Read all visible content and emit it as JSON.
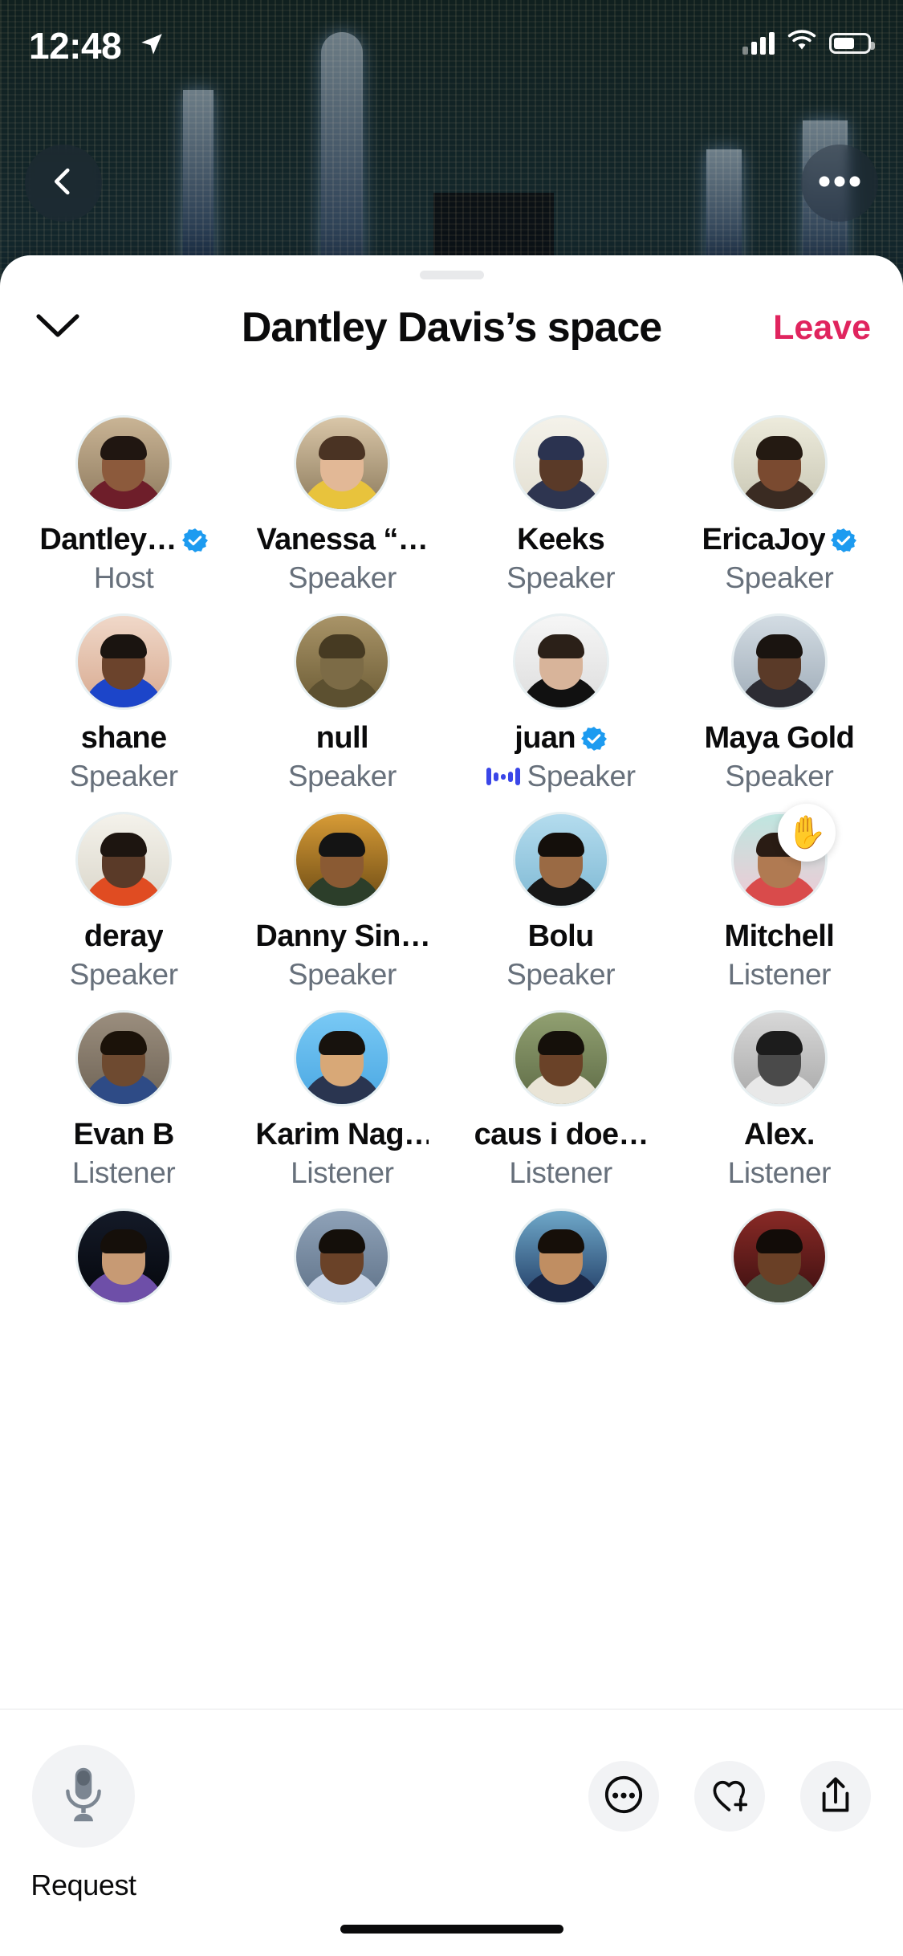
{
  "status_bar": {
    "time": "12:48",
    "location_icon": "location-arrow-icon",
    "signal_icon": "cellular-signal-icon",
    "wifi_icon": "wifi-icon",
    "battery_icon": "battery-icon"
  },
  "photo_overlay": {
    "back_icon": "chevron-left-icon",
    "more_icon": "ellipsis-icon"
  },
  "sheet": {
    "grabber": "drag-handle",
    "collapse_icon": "chevron-down-icon",
    "title": "Dantley Davis’s space",
    "leave_label": "Leave",
    "accent_leave_color": "#E0245E",
    "verified_color": "#1D9BF0",
    "speaking_color": "#3A46E8",
    "role_text_color": "#67707B"
  },
  "participants": [
    {
      "name": "Dantley…",
      "role": "Host",
      "verified": true,
      "speaking": false,
      "hand_raised": false
    },
    {
      "name": "Vanessa “…",
      "role": "Speaker",
      "verified": false,
      "speaking": false,
      "hand_raised": false
    },
    {
      "name": "Keeks",
      "role": "Speaker",
      "verified": false,
      "speaking": false,
      "hand_raised": false
    },
    {
      "name": "EricaJoy",
      "role": "Speaker",
      "verified": true,
      "speaking": false,
      "hand_raised": false
    },
    {
      "name": "shane",
      "role": "Speaker",
      "verified": false,
      "speaking": false,
      "hand_raised": false
    },
    {
      "name": "null",
      "role": "Speaker",
      "verified": false,
      "speaking": false,
      "hand_raised": false
    },
    {
      "name": "juan",
      "role": "Speaker",
      "verified": true,
      "speaking": true,
      "hand_raised": false
    },
    {
      "name": "Maya Gold",
      "role": "Speaker",
      "verified": false,
      "speaking": false,
      "hand_raised": false
    },
    {
      "name": "deray",
      "role": "Speaker",
      "verified": false,
      "speaking": false,
      "hand_raised": false
    },
    {
      "name": "Danny Sin…",
      "role": "Speaker",
      "verified": false,
      "speaking": false,
      "hand_raised": false
    },
    {
      "name": "Bolu",
      "role": "Speaker",
      "verified": false,
      "speaking": false,
      "hand_raised": false
    },
    {
      "name": "Mitchell",
      "role": "Listener",
      "verified": false,
      "speaking": false,
      "hand_raised": true
    },
    {
      "name": "Evan B",
      "role": "Listener",
      "verified": false,
      "speaking": false,
      "hand_raised": false
    },
    {
      "name": "Karim Nag…",
      "role": "Listener",
      "verified": false,
      "speaking": false,
      "hand_raised": false
    },
    {
      "name": "caus i doe…",
      "role": "Listener",
      "verified": false,
      "speaking": false,
      "hand_raised": false
    },
    {
      "name": "Alex.",
      "role": "Listener",
      "verified": false,
      "speaking": false,
      "hand_raised": false
    },
    {
      "name": "",
      "role": "",
      "verified": false,
      "speaking": false,
      "hand_raised": false
    },
    {
      "name": "",
      "role": "",
      "verified": false,
      "speaking": false,
      "hand_raised": false
    },
    {
      "name": "",
      "role": "",
      "verified": false,
      "speaking": false,
      "hand_raised": false
    },
    {
      "name": "",
      "role": "",
      "verified": false,
      "speaking": false,
      "hand_raised": false
    }
  ],
  "hand_raised_emoji": "✋",
  "bottom_bar": {
    "mic_icon": "microphone-icon",
    "mic_label": "Request",
    "more_icon": "more-options-icon",
    "add_people_icon": "heart-plus-icon",
    "share_icon": "share-up-arrow-icon"
  }
}
